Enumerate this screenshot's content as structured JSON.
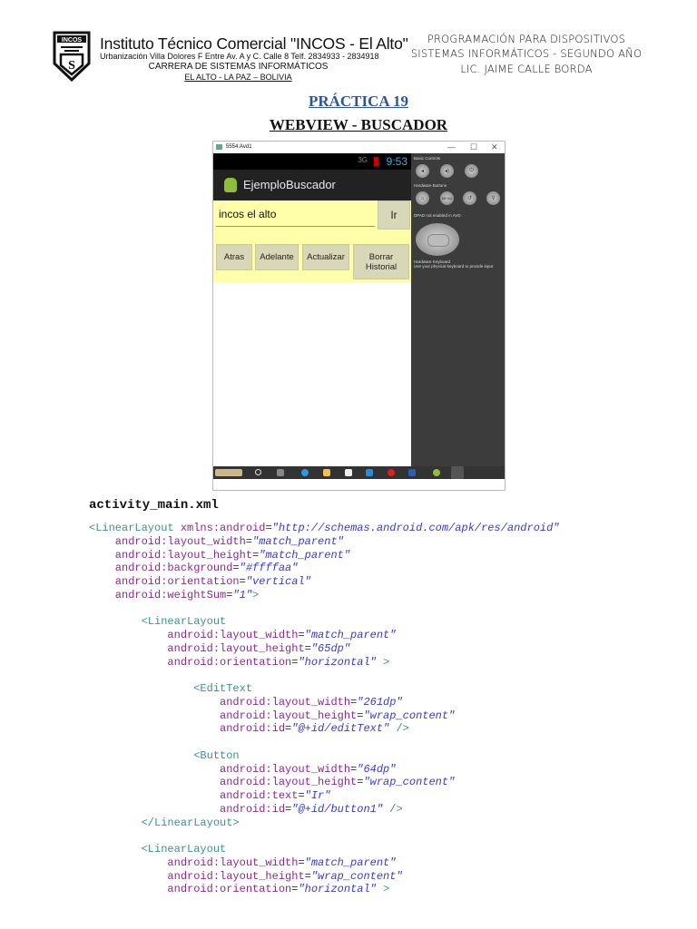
{
  "header": {
    "logo_text": "INCOS",
    "institute": "Instituto Técnico Comercial \"INCOS - El Alto\"",
    "address": "Urbanización Villa Dolores F Entre Av. A y C. Calle 8 Telf. 2834933 - 2834918",
    "career": "CARRERA DE SISTEMAS INFORMÁTICOS",
    "city": "EL ALTO - LA PAZ – BOLIVIA",
    "right": [
      "PROGRAMACIÓN PARA DISPOSITIVOS",
      "SISTEMAS INFORMÁTICOS - SEGUNDO AÑO",
      "LIC.  JAIME CALLE BORDA"
    ]
  },
  "title": "PRÁCTICA 19",
  "subtitle": "WEBVIEW - BUSCADOR",
  "emulator": {
    "window_title": "5554:Avd1",
    "controls": [
      "—",
      "☐",
      "✕"
    ],
    "time": "9:53",
    "signal": "3G",
    "app_title": "EjemploBuscador",
    "edit_value": "incos el alto",
    "go_button": "Ir",
    "buttons": [
      "Atras",
      "Adelante",
      "Actualizar",
      "Borrar Historial"
    ],
    "panel": {
      "basic_controls": "Basic Controls",
      "hardware_buttons": "Hardware Buttons",
      "menu": "MENU",
      "dpad": "DPAD not enabled in AVD",
      "keyboard": "Hardware Keyboard",
      "keyboard_hint": "Use your physical keyboard to provide input"
    },
    "background_color": "#ffffaa"
  },
  "file_label": "activity_main.xml",
  "code": [
    [
      [
        "tag",
        "<LinearLayout "
      ],
      [
        "attr",
        "xmlns:android"
      ],
      [
        "eq",
        "="
      ],
      [
        "val",
        "\"http://schemas.android.com/apk/res/android\""
      ]
    ],
    [
      [
        "attr",
        "    android:layout_width"
      ],
      [
        "eq",
        "="
      ],
      [
        "val",
        "\"match_parent\""
      ]
    ],
    [
      [
        "attr",
        "    android:layout_height"
      ],
      [
        "eq",
        "="
      ],
      [
        "val",
        "\"match_parent\""
      ]
    ],
    [
      [
        "attr",
        "    android:background"
      ],
      [
        "eq",
        "="
      ],
      [
        "val",
        "\"#ffffaa\""
      ]
    ],
    [
      [
        "attr",
        "    android:orientation"
      ],
      [
        "eq",
        "="
      ],
      [
        "val",
        "\"vertical\""
      ]
    ],
    [
      [
        "attr",
        "    android:weightSum"
      ],
      [
        "eq",
        "="
      ],
      [
        "val",
        "\"1\""
      ],
      [
        "tag",
        ">"
      ]
    ],
    [],
    [
      [
        "tag",
        "        <LinearLayout"
      ]
    ],
    [
      [
        "attr",
        "            android:layout_width"
      ],
      [
        "eq",
        "="
      ],
      [
        "val",
        "\"match_parent\""
      ]
    ],
    [
      [
        "attr",
        "            android:layout_height"
      ],
      [
        "eq",
        "="
      ],
      [
        "val",
        "\"65dp\""
      ]
    ],
    [
      [
        "attr",
        "            android:orientation"
      ],
      [
        "eq",
        "="
      ],
      [
        "val",
        "\"horizontal\""
      ],
      [
        "tag",
        " >"
      ]
    ],
    [],
    [
      [
        "tag",
        "                <EditText"
      ]
    ],
    [
      [
        "attr",
        "                    android:layout_width"
      ],
      [
        "eq",
        "="
      ],
      [
        "val",
        "\"261dp\""
      ]
    ],
    [
      [
        "attr",
        "                    android:layout_height"
      ],
      [
        "eq",
        "="
      ],
      [
        "val",
        "\"wrap_content\""
      ]
    ],
    [
      [
        "attr",
        "                    android:id"
      ],
      [
        "eq",
        "="
      ],
      [
        "val",
        "\"@+id/editText\""
      ],
      [
        "tag",
        " />"
      ]
    ],
    [],
    [
      [
        "tag",
        "                <Button"
      ]
    ],
    [
      [
        "attr",
        "                    android:layout_width"
      ],
      [
        "eq",
        "="
      ],
      [
        "val",
        "\"64dp\""
      ]
    ],
    [
      [
        "attr",
        "                    android:layout_height"
      ],
      [
        "eq",
        "="
      ],
      [
        "val",
        "\"wrap_content\""
      ]
    ],
    [
      [
        "attr",
        "                    android:text"
      ],
      [
        "eq",
        "="
      ],
      [
        "val",
        "\"Ir\""
      ]
    ],
    [
      [
        "attr",
        "                    android:id"
      ],
      [
        "eq",
        "="
      ],
      [
        "val",
        "\"@+id/button1\""
      ],
      [
        "tag",
        " />"
      ]
    ],
    [
      [
        "tag",
        "        </LinearLayout>"
      ]
    ],
    [],
    [
      [
        "tag",
        "        <LinearLayout"
      ]
    ],
    [
      [
        "attr",
        "            android:layout_width"
      ],
      [
        "eq",
        "="
      ],
      [
        "val",
        "\"match_parent\""
      ]
    ],
    [
      [
        "attr",
        "            android:layout_height"
      ],
      [
        "eq",
        "="
      ],
      [
        "val",
        "\"wrap_content\""
      ]
    ],
    [
      [
        "attr",
        "            android:orientation"
      ],
      [
        "eq",
        "="
      ],
      [
        "val",
        "\"horizontal\""
      ],
      [
        "tag",
        " >"
      ]
    ]
  ]
}
